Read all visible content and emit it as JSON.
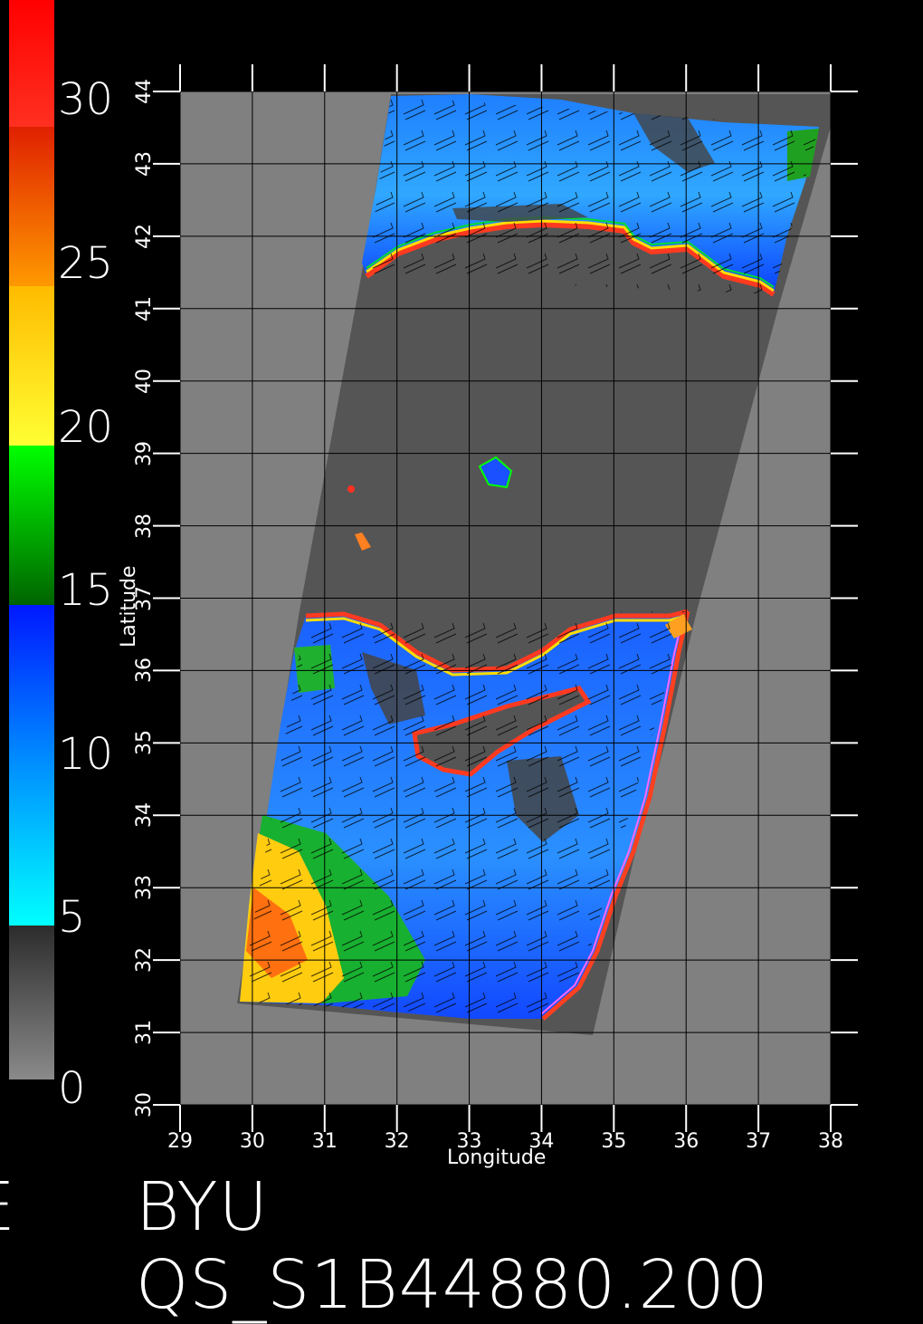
{
  "colorbar": {
    "labels": [
      "30",
      "25",
      "20",
      "15",
      "10",
      "5",
      "0"
    ],
    "values": [
      30,
      25,
      20,
      15,
      10,
      5,
      0
    ],
    "range": [
      0,
      33
    ],
    "stops": [
      {
        "from": 0,
        "to": 5,
        "colors": [
          "#8a8a8a",
          "#2c2c2c"
        ]
      },
      {
        "from": 5,
        "to": 10,
        "colors": [
          "#00ffff",
          "#0090ff"
        ]
      },
      {
        "from": 10,
        "to": 15,
        "colors": [
          "#0090ff",
          "#0018ff"
        ]
      },
      {
        "from": 15,
        "to": 20,
        "colors": [
          "#006400",
          "#00ff00"
        ]
      },
      {
        "from": 20,
        "to": 25,
        "colors": [
          "#ffff33",
          "#ffbb00"
        ]
      },
      {
        "from": 25,
        "to": 30,
        "colors": [
          "#ff9900",
          "#e02000"
        ]
      },
      {
        "from": 30,
        "to": 33,
        "colors": [
          "#ff2020",
          "#ff0000"
        ]
      }
    ]
  },
  "map": {
    "xlabel": "Longitude",
    "ylabel": "Latitude",
    "lon_ticks": [
      "29",
      "30",
      "31",
      "32",
      "33",
      "34",
      "35",
      "36",
      "37",
      "38"
    ],
    "lat_ticks": [
      "30",
      "31",
      "32",
      "33",
      "34",
      "35",
      "36",
      "37",
      "38",
      "39",
      "40",
      "41",
      "42",
      "43",
      "44"
    ],
    "lon_range": [
      29,
      38
    ],
    "lat_range": [
      30,
      44
    ],
    "colors": {
      "background_outside": "#808080",
      "land_swath": "#555555",
      "grid": "#000000"
    }
  },
  "footer": {
    "title": "BYU QS_S1B44880.200",
    "left_fragment": "E"
  }
}
